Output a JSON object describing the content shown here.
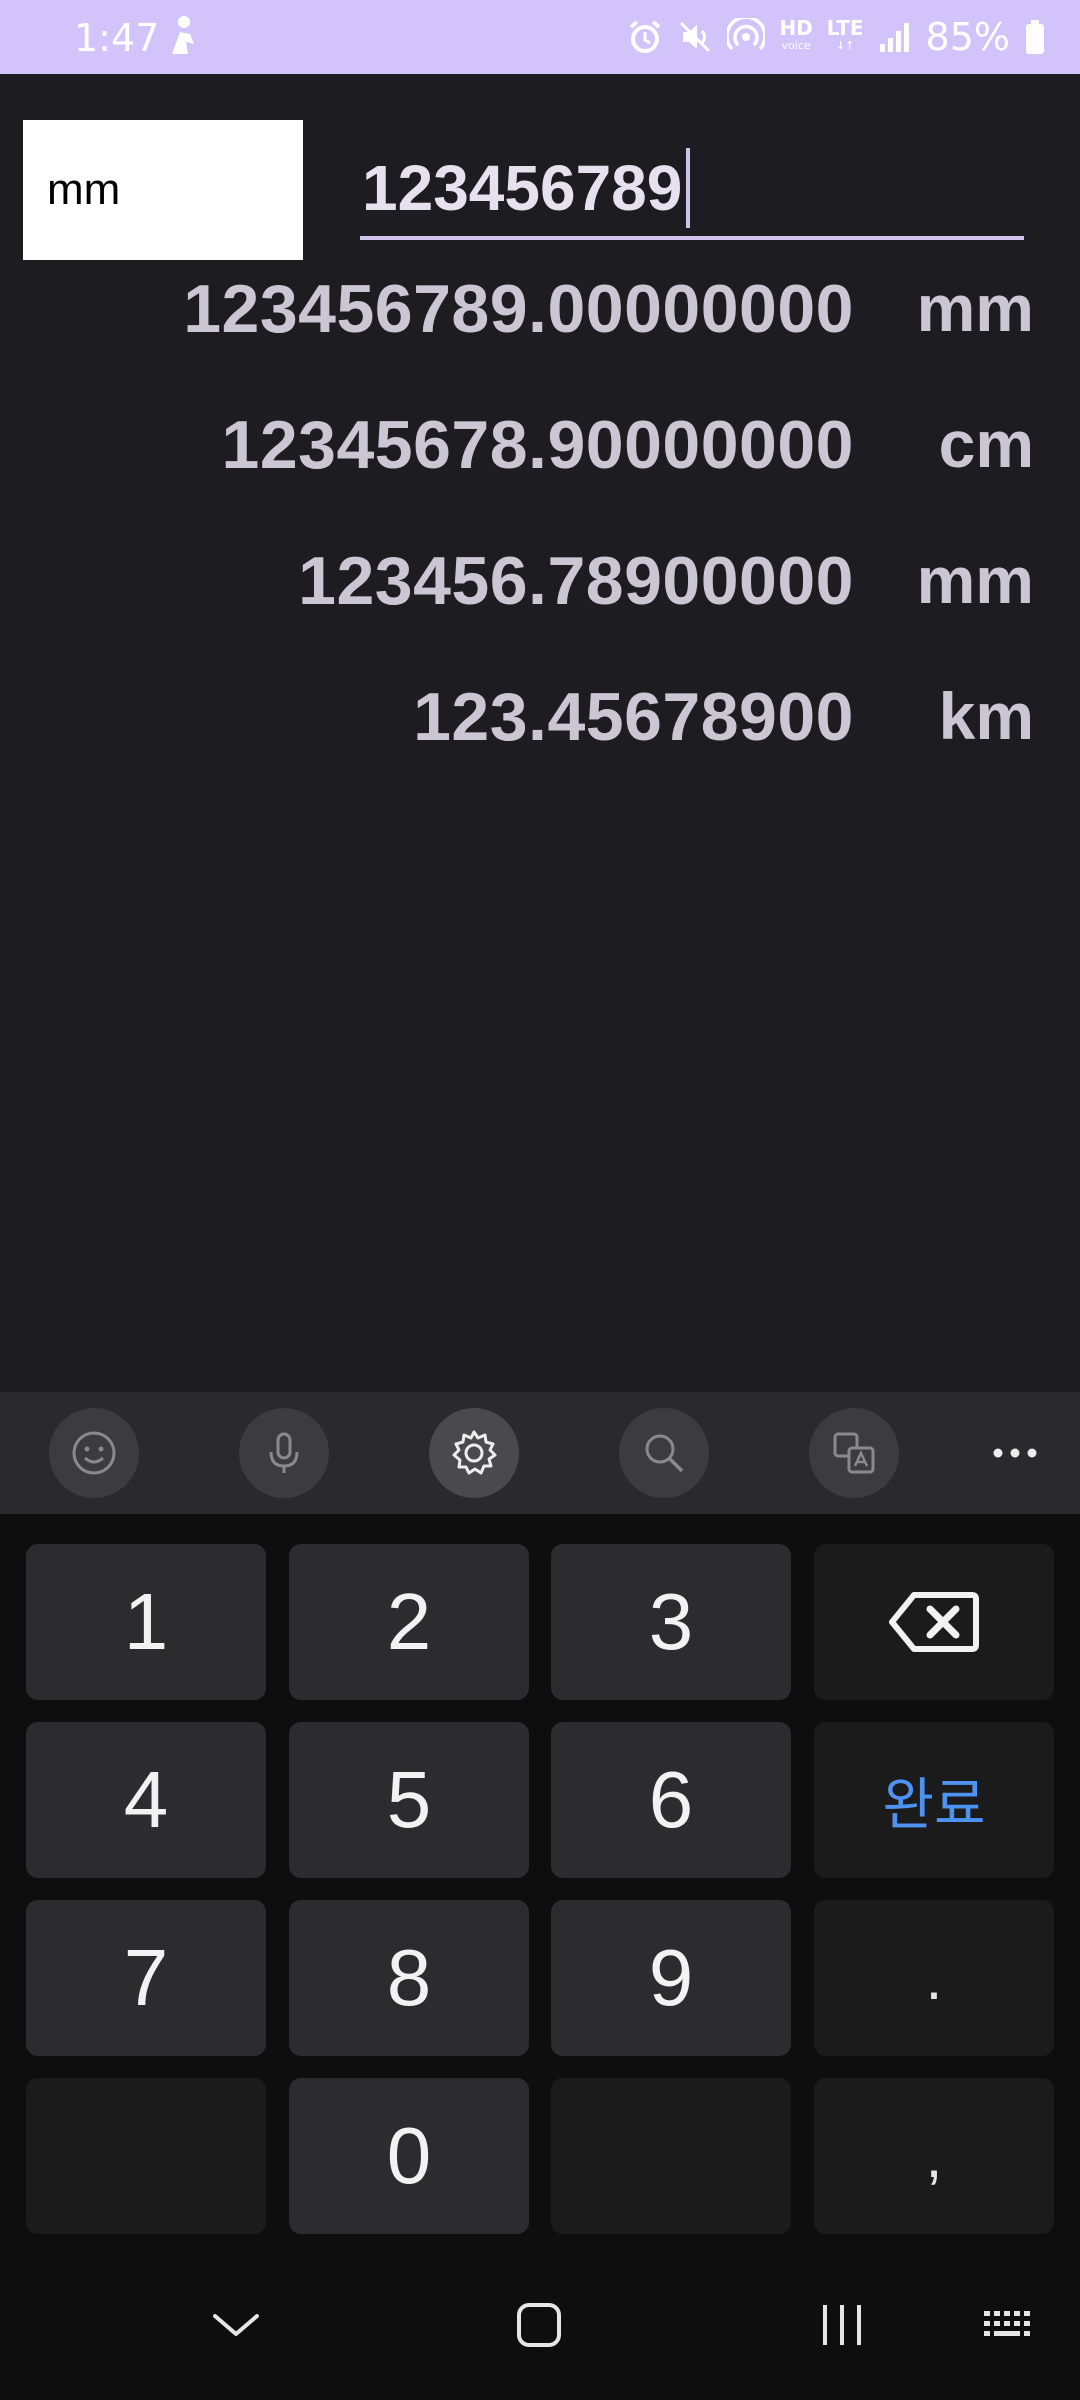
{
  "status_bar": {
    "time": "1:47",
    "hd_label": "HD",
    "hd_sub": "voice",
    "lte_label": "LTE",
    "battery": "85%"
  },
  "converter": {
    "unit_selected": "mm",
    "input_value": "123456789",
    "results": [
      {
        "value": "123456789.00000000",
        "unit": "mm"
      },
      {
        "value": "12345678.90000000",
        "unit": "cm"
      },
      {
        "value": "123456.78900000",
        "unit": "mm"
      },
      {
        "value": "123.45678900",
        "unit": "km"
      }
    ]
  },
  "keyboard": {
    "toolbar_icons": [
      "emoji-icon",
      "microphone-icon",
      "settings-icon",
      "search-icon",
      "translate-icon",
      "more-icon"
    ],
    "keys": {
      "k1": "1",
      "k2": "2",
      "k3": "3",
      "k4": "4",
      "k5": "5",
      "k6": "6",
      "k7": "7",
      "k8": "8",
      "k9": "9",
      "k0": "0",
      "done": "완료",
      "dot": ".",
      "comma": ","
    },
    "accent_color": "#4f93f2"
  },
  "nav_bar": {
    "icons": [
      "hide-keyboard-icon",
      "home-icon",
      "recents-icon",
      "keyboard-switch-icon"
    ]
  }
}
